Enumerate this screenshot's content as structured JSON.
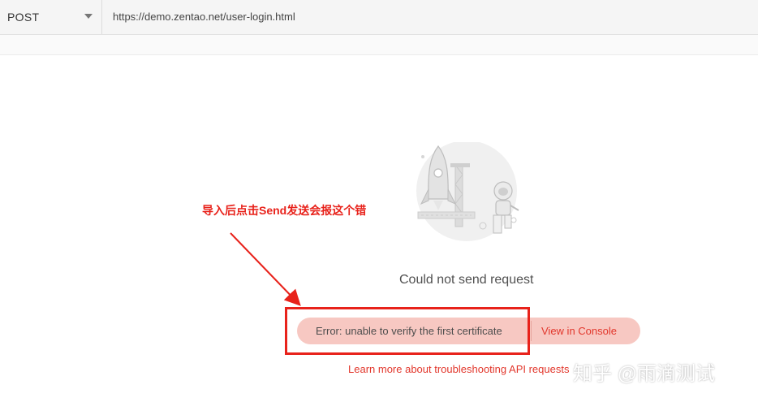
{
  "request": {
    "method": "POST",
    "url": "https://demo.zentao.net/user-login.html"
  },
  "response": {
    "message": "Could not send request",
    "error": "Error: unable to verify the first certificate",
    "view_console": "View in Console",
    "learn_more": "Learn more about troubleshooting API requests"
  },
  "annotation": {
    "text": "导入后点击Send发送会报这个错",
    "color": "#e8221b"
  },
  "watermark": {
    "text": "知乎 @雨滴测试"
  },
  "icons": {
    "method_dropdown": "chevron-down-icon",
    "illustration": "rocket-astronaut-illustration"
  }
}
